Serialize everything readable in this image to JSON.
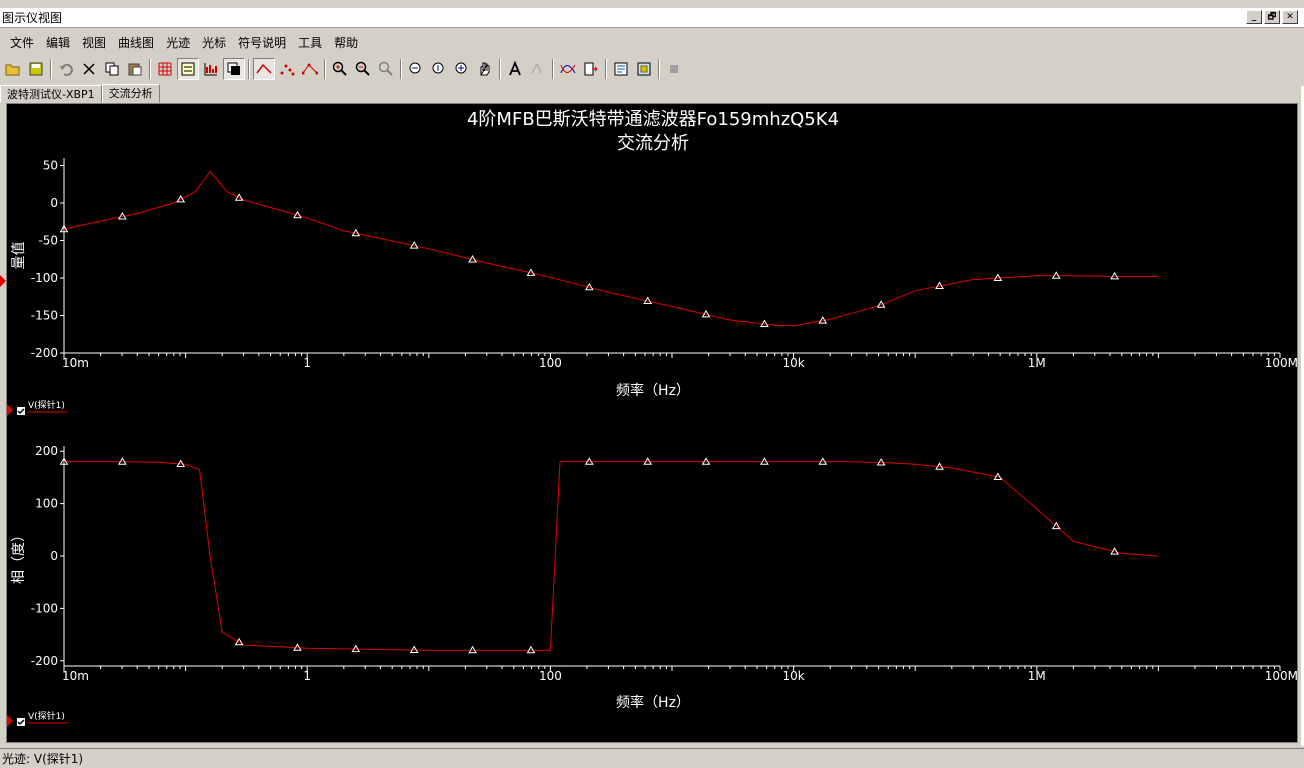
{
  "window": {
    "title": "图示仪视图",
    "buttons": [
      "_",
      "🗗",
      "✕"
    ]
  },
  "menu": [
    "文件",
    "编辑",
    "视图",
    "曲线图",
    "光迹",
    "光标",
    "符号说明",
    "工具",
    "帮助"
  ],
  "tabs": [
    {
      "label": "波特测试仪-XBP1",
      "active": false
    },
    {
      "label": "交流分析",
      "active": true
    }
  ],
  "status": {
    "text": "光迹: V(探针1)"
  },
  "colors": {
    "trace": "#e00000",
    "background": "#000000",
    "text": "#ffffff"
  },
  "chart_data": [
    {
      "type": "line",
      "title": "4阶MFB巴斯沃特带通滤波器Fo159mhzQ5K4",
      "subtitle": "交流分析",
      "xlabel": "频率（Hz）",
      "ylabel": "量值",
      "x_scale": "log",
      "xlim": [
        0.01,
        100000000
      ],
      "ylim": [
        -200,
        60
      ],
      "x_ticks": [
        0.01,
        1,
        100,
        10000,
        1000000,
        100000000
      ],
      "x_tick_labels": [
        "10m",
        "1",
        "100",
        "10k",
        "1M",
        "100M"
      ],
      "y_ticks": [
        50,
        0,
        -50,
        -100,
        -150,
        -200
      ],
      "y_tick_labels": [
        "50",
        "0",
        "-50",
        "-100",
        "-150",
        "-200"
      ],
      "legend": "V(探针1)",
      "series": [
        {
          "name": "V(探针1)",
          "x": [
            0.01,
            0.02,
            0.04,
            0.08,
            0.12,
            0.159,
            0.22,
            0.3,
            0.5,
            1,
            2,
            3,
            10,
            30,
            100,
            300,
            1000,
            3000,
            7000,
            10000,
            20000,
            50000,
            100000,
            300000,
            1000000,
            2000000,
            5000000,
            10000000
          ],
          "y": [
            -35,
            -24,
            -14,
            0,
            15,
            42,
            15,
            4,
            -6,
            -20,
            -37,
            -43,
            -61,
            -80,
            -99,
            -119,
            -138,
            -156,
            -163,
            -164,
            -155,
            -137,
            -117,
            -102,
            -97,
            -97,
            -98,
            -98
          ]
        }
      ]
    },
    {
      "type": "line",
      "xlabel": "频率（Hz）",
      "ylabel": "相（度）",
      "x_scale": "log",
      "xlim": [
        0.01,
        100000000
      ],
      "ylim": [
        -210,
        210
      ],
      "x_ticks": [
        0.01,
        1,
        100,
        10000,
        1000000,
        100000000
      ],
      "x_tick_labels": [
        "10m",
        "1",
        "100",
        "10k",
        "1M",
        "100M"
      ],
      "y_ticks": [
        200,
        100,
        0,
        -100,
        -200
      ],
      "y_tick_labels": [
        "200",
        "100",
        "0",
        "-100",
        "-200"
      ],
      "legend": "V(探针1)",
      "series": [
        {
          "name": "V(探针1)",
          "x": [
            0.01,
            0.03,
            0.06,
            0.1,
            0.13,
            0.159,
            0.2,
            0.3,
            1,
            3,
            10,
            30,
            100,
            120,
            300,
            1000,
            3000,
            10000,
            30000,
            60000,
            100000,
            200000,
            500000,
            1000000,
            2000000,
            5000000,
            10000000
          ],
          "y": [
            180,
            180,
            179,
            175,
            165,
            0,
            -145,
            -170,
            -176,
            -178,
            -180,
            -180,
            -180,
            180,
            180,
            180,
            180,
            180,
            180,
            178,
            175,
            168,
            150,
            90,
            28,
            5,
            0
          ]
        }
      ]
    }
  ]
}
